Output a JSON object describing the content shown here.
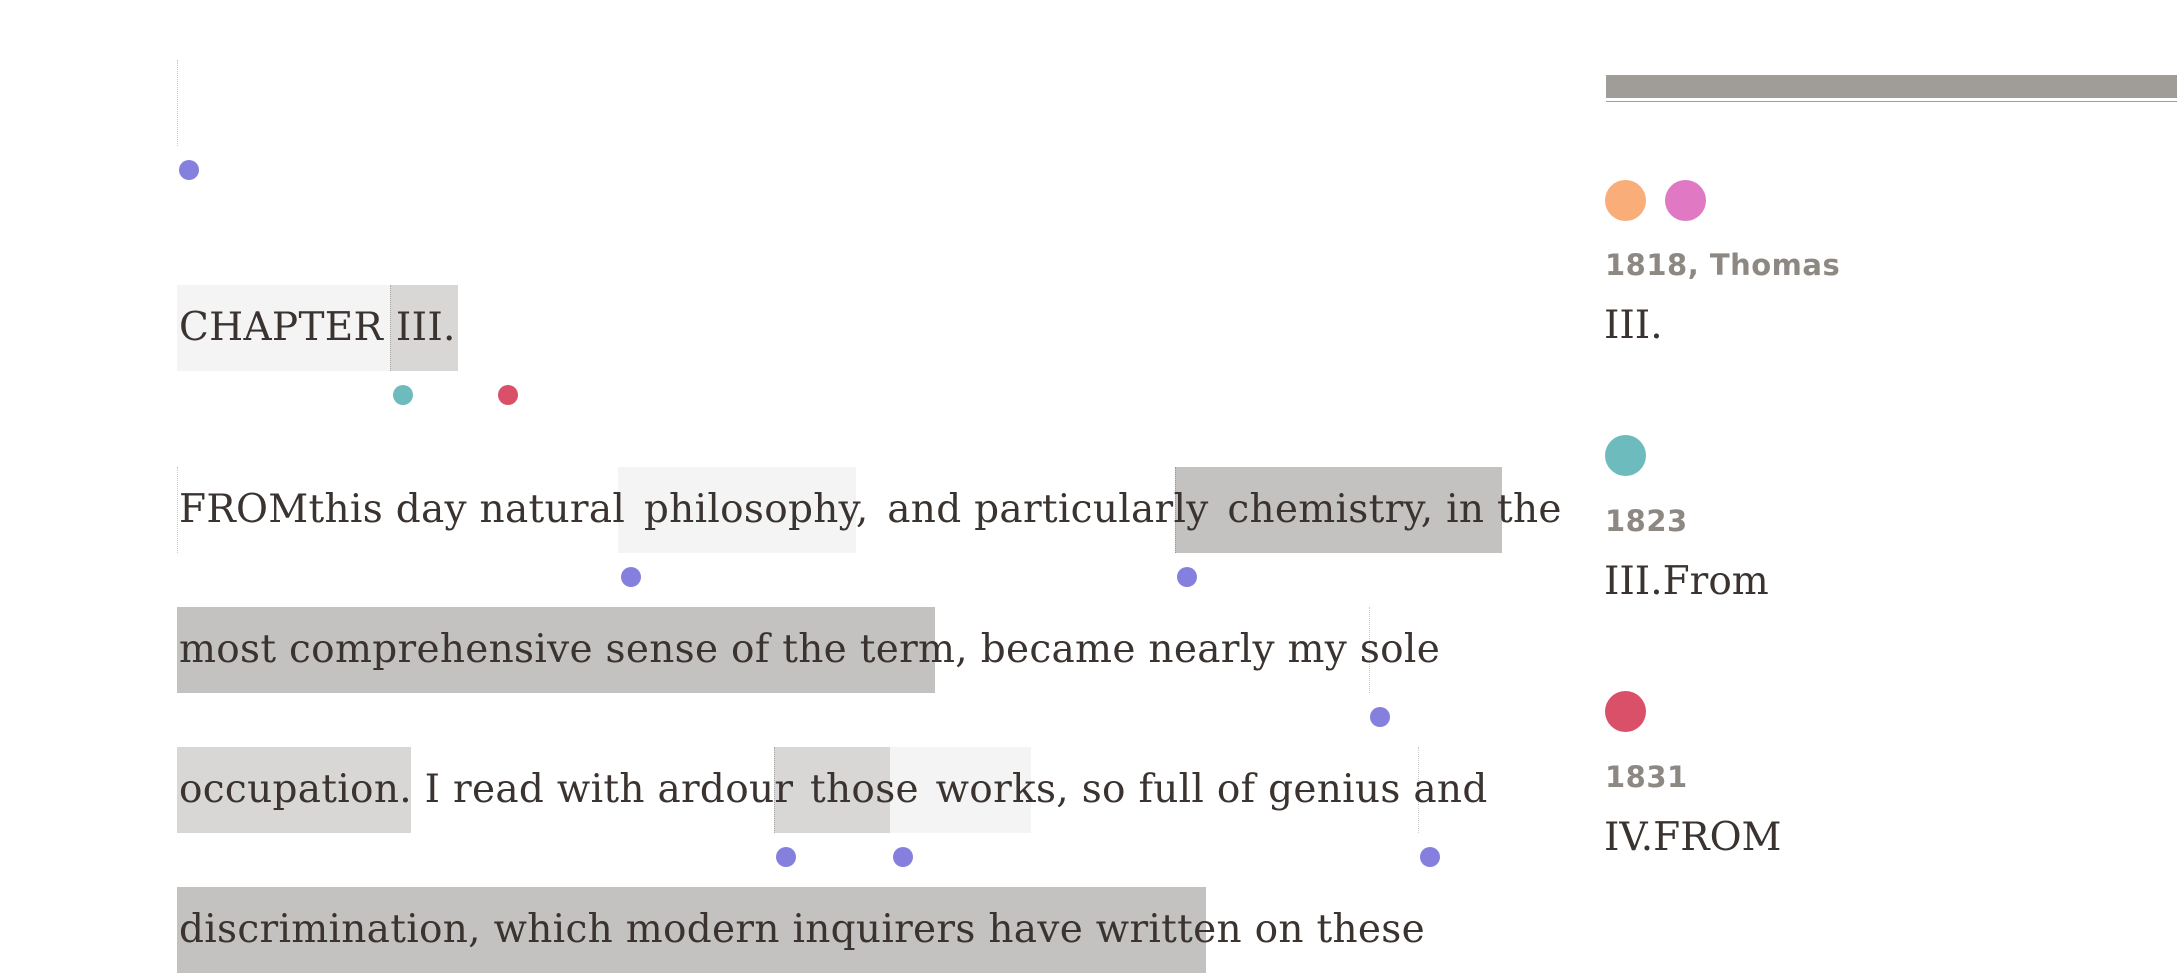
{
  "colors": {
    "marker": "#8580de",
    "teal": "#6dbbbd",
    "red": "#d95068",
    "orange": "#f9ad78",
    "pink": "#e178c3",
    "highlight_light": "#f4f4f4",
    "highlight_mid": "#d8d7d6",
    "highlight_dark": "#c4c2c0",
    "sidebar_bar": "#a09c98"
  },
  "text": {
    "chapter": "CHAPTER",
    "chapter_num": "III.",
    "line1": {
      "w1": "FROMthis day natural",
      "w2": "philosophy,",
      "w3": "and particularly",
      "w4": "chemistry, in the"
    },
    "line2": {
      "w1": "most comprehensive sense of the term,",
      "w2": "became nearly my sole"
    },
    "line3": {
      "w1": "occupation.",
      "w2": "I read with ardour",
      "w3": "those",
      "w4": "works,",
      "w5": "so full of genius and"
    },
    "line4": {
      "w1": "discrimination, which modern inquirers have written",
      "w2": "on these"
    }
  },
  "sidebar": {
    "versions": [
      {
        "meta": "1818, Thomas",
        "heading": "III.",
        "dots": [
          "orange",
          "pink"
        ]
      },
      {
        "meta": "1823",
        "heading": "III.From",
        "dots": [
          "teal"
        ]
      },
      {
        "meta": "1831",
        "heading": "IV.FROM",
        "dots": [
          "red"
        ]
      }
    ]
  }
}
